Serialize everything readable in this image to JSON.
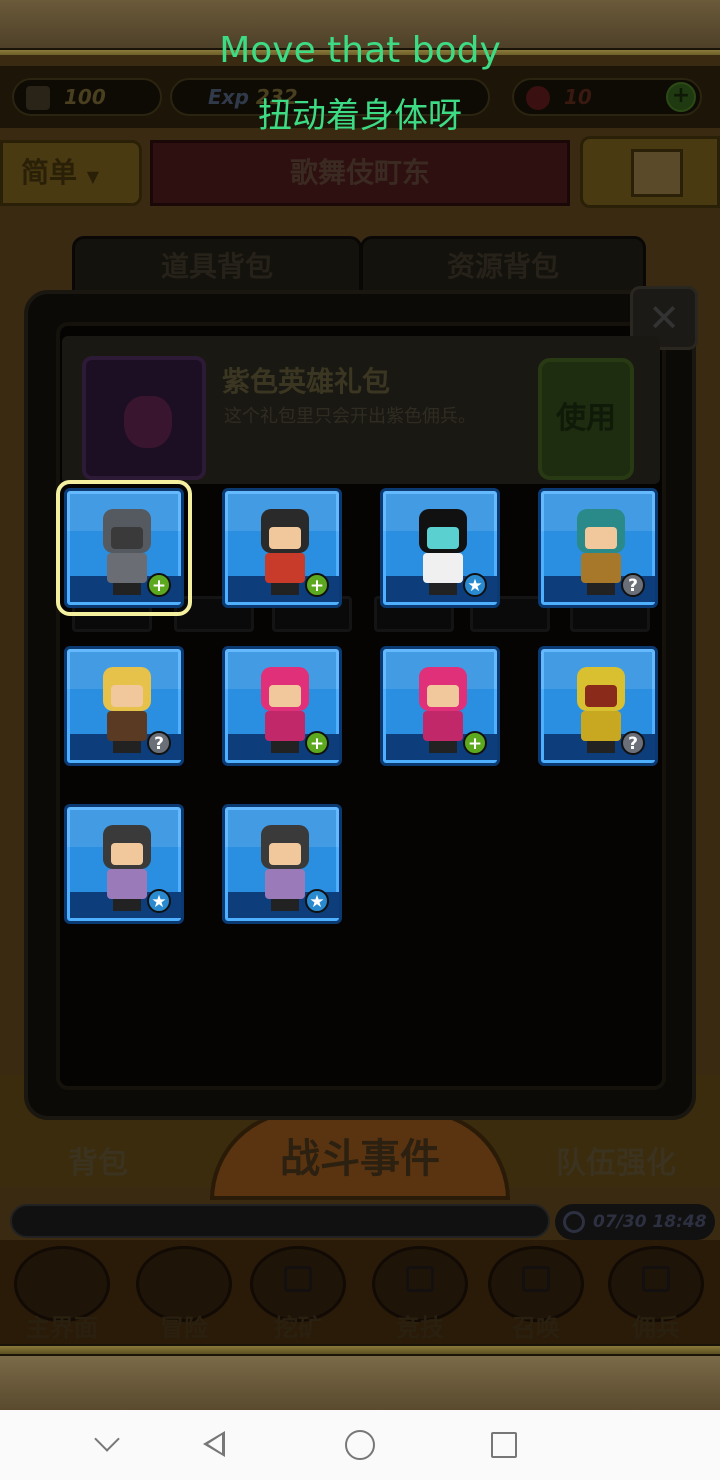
{
  "caption": {
    "english": "Move that body",
    "chinese": "扭动着身体呀"
  },
  "stats": {
    "attack": "100",
    "exp_label": "Exp",
    "exp": "232",
    "gems": "10"
  },
  "difficulty": {
    "label": "简单",
    "arrow": "▼"
  },
  "stage_name": "歌舞伎町东",
  "tabs": [
    "道具背包",
    "资源背包"
  ],
  "close_glyph": "✕",
  "selected_item": {
    "name": "紫色英雄礼包",
    "description": "这个礼包里只会开出紫色佣兵。",
    "use_button": "使用"
  },
  "heroes": [
    {
      "hair": "#555a60",
      "face": "#3a3a3a",
      "body": "#6a6e74",
      "badge": "plus",
      "glyph": "+",
      "selected": true
    },
    {
      "hair": "#2a2a2a",
      "face": "#f0c89c",
      "body": "#c83a2a",
      "badge": "plus",
      "glyph": "+"
    },
    {
      "hair": "#111111",
      "face": "#5ad0d0",
      "body": "#f0f0f0",
      "badge": "star",
      "glyph": "★"
    },
    {
      "hair": "#2a8a8a",
      "face": "#f0c89c",
      "body": "#a8782a",
      "badge": "q",
      "glyph": "?"
    },
    {
      "hair": "#e6c24a",
      "face": "#f0c89c",
      "body": "#5a3a22",
      "badge": "q",
      "glyph": "?"
    },
    {
      "hair": "#e0307a",
      "face": "#f0c89c",
      "body": "#c0286a",
      "badge": "plus",
      "glyph": "+"
    },
    {
      "hair": "#e0307a",
      "face": "#f0c89c",
      "body": "#c0286a",
      "badge": "plus",
      "glyph": "+"
    },
    {
      "hair": "#d8c030",
      "face": "#8a2a1a",
      "body": "#c8a820",
      "badge": "q",
      "glyph": "?"
    },
    {
      "hair": "#3a3a3a",
      "face": "#f0c89c",
      "body": "#9a7ab8",
      "badge": "star",
      "glyph": "★"
    },
    {
      "hair": "#3a3a3a",
      "face": "#f0c89c",
      "body": "#9a7ab8",
      "badge": "star",
      "glyph": "★"
    }
  ],
  "bottom": {
    "bag": "背包",
    "battle": "战斗事件",
    "team": "队伍强化"
  },
  "timestamp": "07/30 18:48",
  "nav": [
    "主界面",
    "冒险",
    "挖矿",
    "竞技",
    "召唤",
    "佣兵"
  ]
}
